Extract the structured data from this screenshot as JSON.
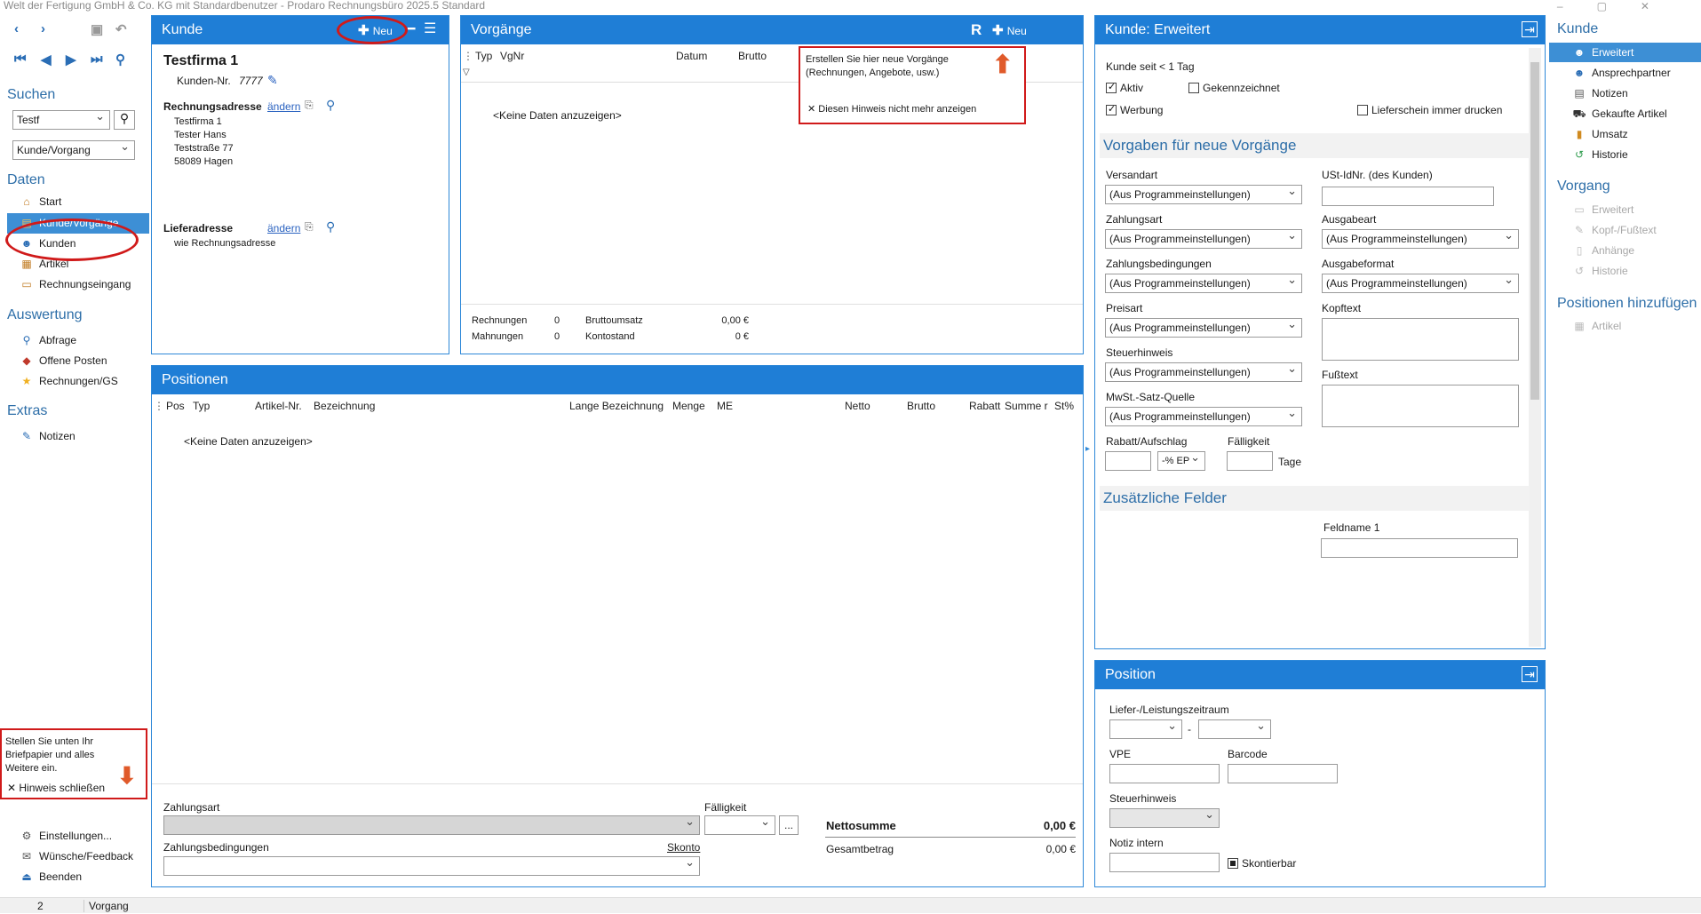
{
  "window": {
    "title": "Welt der Fertigung GmbH & Co. KG mit Standardbenutzer  -  Prodaro Rechnungsbüro 2025.5 Standard"
  },
  "nav": {
    "search_heading": "Suchen",
    "search_value": "Testf",
    "search_mode": "Kunde/Vorgang",
    "daten_heading": "Daten",
    "daten_items": [
      "Start",
      "Kunde/Vorgänge",
      "Kunden",
      "Artikel",
      "Rechnungseingang"
    ],
    "auswertung_heading": "Auswertung",
    "auswertung_items": [
      "Abfrage",
      "Offene Posten",
      "Rechnungen/GS"
    ],
    "extras_heading": "Extras",
    "extras_items": [
      "Notizen"
    ],
    "bottom_items": [
      "Einstellungen...",
      "Wünsche/Feedback",
      "Beenden"
    ],
    "hint_text": "Stellen Sie unten Ihr Briefpapier und alles Weitere ein.",
    "hint_close": "Hinweis schließen"
  },
  "kunde": {
    "title": "Kunde",
    "new_label": "Neu",
    "name": "Testfirma 1",
    "number_label": "Kunden-Nr.",
    "number": "7777",
    "billing_label": "Rechnungsadresse",
    "change_label": "ändern",
    "billing_lines": [
      "Testfirma 1",
      "Tester Hans",
      "Teststraße 77",
      "58089 Hagen"
    ],
    "delivery_label": "Lieferadresse",
    "delivery_line": "wie Rechnungsadresse"
  },
  "vorgaenge": {
    "title": "Vorgänge",
    "r_label": "R",
    "new_label": "Neu",
    "columns": [
      "Typ",
      "VgNr",
      "Datum",
      "Brutto"
    ],
    "empty": "<Keine Daten anzuzeigen>",
    "tooltip_text": "Erstellen Sie hier neue Vorgänge (Rechnungen, Angebote, usw.)",
    "tooltip_dismiss": "Diesen Hinweis nicht mehr anzeigen",
    "summary": {
      "rechnungen_label": "Rechnungen",
      "rechnungen": "0",
      "mahnungen_label": "Mahnungen",
      "mahnungen": "0",
      "umsatz_label": "Bruttoumsatz",
      "umsatz": "0,00 €",
      "konto_label": "Kontostand",
      "konto": "0 €"
    }
  },
  "positionen": {
    "title": "Positionen",
    "columns": [
      "Pos",
      "Typ",
      "Artikel-Nr.",
      "Bezeichnung",
      "Lange Bezeichnung",
      "Menge",
      "ME",
      "Netto",
      "Brutto",
      "Rabatt",
      "Summe r",
      "St%"
    ],
    "empty": "<Keine Daten anzuzeigen>",
    "zahlungsart_label": "Zahlungsart",
    "faelligkeit_label": "Fälligkeit",
    "ellipsis": "...",
    "zahlungsbed_label": "Zahlungsbedingungen",
    "skonto_label": "Skonto",
    "netto_label": "Nettosumme",
    "netto_value": "0,00  €",
    "gesamt_label": "Gesamtbetrag",
    "gesamt_value": "0,00  €"
  },
  "erweitert": {
    "title": "Kunde: Erweitert",
    "kunde_seit": "Kunde seit < 1 Tag",
    "aktiv": "Aktiv",
    "gekennzeichnet": "Gekennzeichnet",
    "werbung": "Werbung",
    "lieferschein": "Lieferschein immer drucken",
    "vorgaben_heading": "Vorgaben für neue Vorgänge",
    "default_option": "(Aus Programmeinstellungen)",
    "versandart": "Versandart",
    "ustid": "USt-IdNr. (des Kunden)",
    "zahlungsart": "Zahlungsart",
    "ausgabeart": "Ausgabeart",
    "zahlungsbed": "Zahlungsbedingungen",
    "ausgabeformat": "Ausgabeformat",
    "preisart": "Preisart",
    "kopftext": "Kopftext",
    "steuerhinweis": "Steuerhinweis",
    "fusstext": "Fußtext",
    "mwst": "MwSt.-Satz-Quelle",
    "rabatt": "Rabatt/Aufschlag",
    "rabatt_unit": "-% EP",
    "faelligkeit": "Fälligkeit",
    "tage": "Tage",
    "zusatz_heading": "Zusätzliche Felder",
    "feldname": "Feldname 1"
  },
  "position_panel": {
    "title": "Position",
    "zeitraum": "Liefer-/Leistungszeitraum",
    "dash": "-",
    "vpe": "VPE",
    "barcode": "Barcode",
    "steuerhinweis": "Steuerhinweis",
    "notiz": "Notiz intern",
    "skontierbar": "Skontierbar"
  },
  "right": {
    "kunde_heading": "Kunde",
    "kunde_items": [
      "Erweitert",
      "Ansprechpartner",
      "Notizen",
      "Gekaufte Artikel",
      "Umsatz",
      "Historie"
    ],
    "vorgang_heading": "Vorgang",
    "vorgang_items": [
      "Erweitert",
      "Kopf-/Fußtext",
      "Anhänge",
      "Historie"
    ],
    "positionen_heading": "Positionen hinzufügen",
    "positionen_items": [
      "Artikel"
    ]
  },
  "status": {
    "count": "2",
    "label": "Vorgang"
  },
  "colors": {
    "accent": "#1f7ed6",
    "selection": "#3d8fd5",
    "highlight_red": "#d01a1a"
  }
}
